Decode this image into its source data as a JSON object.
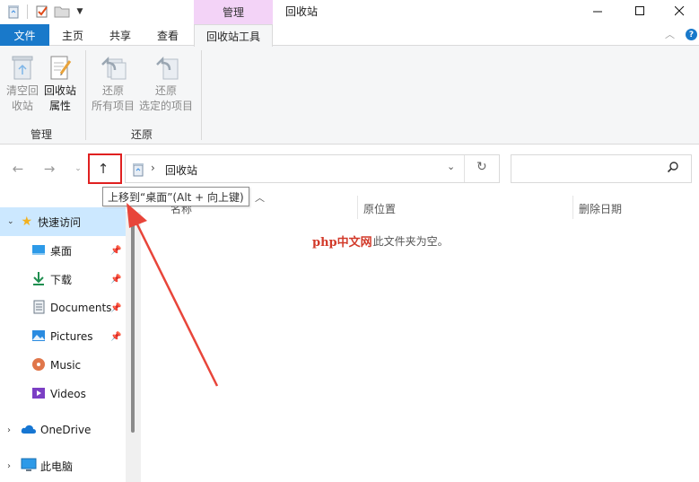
{
  "window": {
    "context_tab_group": "管理",
    "title": "回收站"
  },
  "tabs": {
    "file": "文件",
    "home": "主页",
    "share": "共享",
    "view": "查看",
    "recycle_tools": "回收站工具"
  },
  "ribbon": {
    "empty_bin_line1": "清空回",
    "empty_bin_line2": "收站",
    "properties_line1": "回收站",
    "properties_line2": "属性",
    "restore_all_line1": "还原",
    "restore_all_line2": "所有项目",
    "restore_sel_line1": "还原",
    "restore_sel_line2": "选定的项目",
    "group_manage": "管理",
    "group_restore": "还原"
  },
  "address": {
    "location": "回收站",
    "search_placeholder": ""
  },
  "tooltip": "上移到“桌面”(Alt + 向上键)",
  "columns": {
    "name": "名称",
    "original_location": "原位置",
    "deleted_date": "删除日期"
  },
  "empty_message": {
    "watermark": "php中文网",
    "text": "此文件夹为空。"
  },
  "sidebar": {
    "quick_access": "快速访问",
    "items": [
      {
        "label": "桌面",
        "icon": "desktop-icon",
        "pinned": true
      },
      {
        "label": "下载",
        "icon": "download-icon",
        "pinned": true
      },
      {
        "label": "Documents",
        "icon": "documents-icon",
        "pinned": true
      },
      {
        "label": "Pictures",
        "icon": "pictures-icon",
        "pinned": true
      },
      {
        "label": "Music",
        "icon": "music-icon",
        "pinned": false
      },
      {
        "label": "Videos",
        "icon": "videos-icon",
        "pinned": false
      }
    ],
    "onedrive": "OneDrive",
    "this_pc": "此电脑"
  },
  "colors": {
    "file_tab": "#1979ca",
    "context_tab": "#f3d3f7",
    "selection": "#cce8ff",
    "annotation_red": "#e02020"
  }
}
